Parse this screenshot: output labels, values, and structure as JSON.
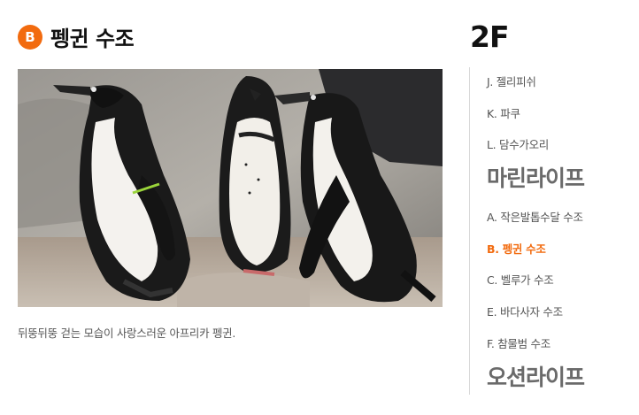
{
  "header": {
    "badge": "B",
    "title": "펭귄 수조"
  },
  "photo": {
    "caption": "뒤뚱뒤뚱 걷는 모습이 사랑스러운 아프리카 펭귄."
  },
  "floor": "2F",
  "sidebar": {
    "items": [
      {
        "label": "J. 젤리피쉬"
      },
      {
        "label": "K. 파쿠"
      },
      {
        "label": "L. 담수가오리"
      },
      {
        "label": "마린라이프"
      },
      {
        "label": "A. 작은발톱수달 수조"
      },
      {
        "label": "B. 펭귄 수조"
      },
      {
        "label": "C. 벨루가 수조"
      },
      {
        "label": "E. 바다사자 수조"
      },
      {
        "label": "F. 참물범 수조"
      },
      {
        "label": "오션라이프"
      }
    ]
  },
  "colors": {
    "accent": "#f26b0f",
    "section": "#6a6a6a",
    "divider": "#d8d8d8"
  }
}
